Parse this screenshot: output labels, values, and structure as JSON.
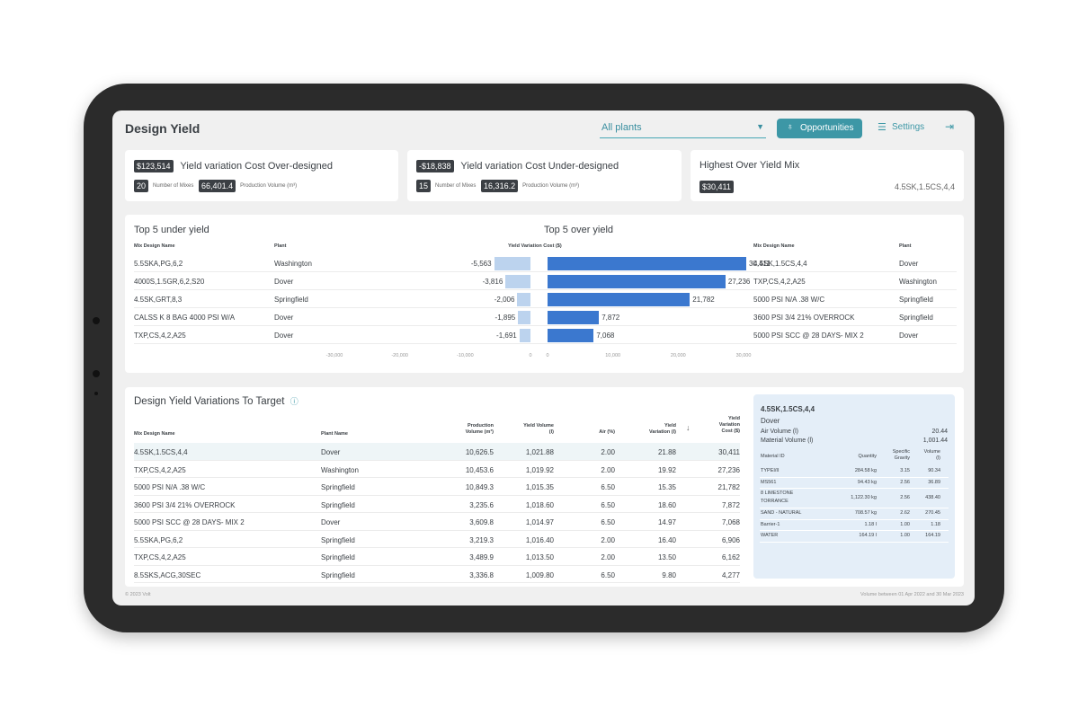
{
  "header": {
    "title": "Design Yield",
    "plant_select": "All plants",
    "opportunities_label": "Opportunities",
    "settings_label": "Settings"
  },
  "kpis": {
    "over": {
      "amount": "$123,514",
      "title": "Yield variation Cost Over-designed",
      "mixes": "20",
      "mixes_label": "Number of Mixes",
      "volume": "66,401.4",
      "volume_label": "Production Volume (m³)"
    },
    "under": {
      "amount": "-$18,838",
      "title": "Yield variation Cost Under-designed",
      "mixes": "15",
      "mixes_label": "Number of Mixes",
      "volume": "16,316.2",
      "volume_label": "Production Volume (m³)"
    },
    "highest": {
      "title": "Highest Over Yield Mix",
      "amount": "$30,411",
      "mix": "4.5SK,1.5CS,4,4"
    }
  },
  "top5": {
    "under_title": "Top 5 under yield",
    "over_title": "Top 5 over yield",
    "col_mix": "Mix Design Name",
    "col_plant": "Plant",
    "col_cost": "Yield Variation Cost ($)",
    "under_rows": [
      {
        "mix": "5.5SKA,PG,6,2",
        "plant": "Washington",
        "value": -5563,
        "label": "-5,563"
      },
      {
        "mix": "4000S,1.5GR,6,2,S20",
        "plant": "Dover",
        "value": -3816,
        "label": "-3,816"
      },
      {
        "mix": "4.5SK,GRT,8,3",
        "plant": "Springfield",
        "value": -2006,
        "label": "-2,006"
      },
      {
        "mix": "CALSS K 8 BAG 4000 PSI W/A",
        "plant": "Dover",
        "value": -1895,
        "label": "-1,895"
      },
      {
        "mix": "TXP,CS,4,2,A25",
        "plant": "Dover",
        "value": -1691,
        "label": "-1,691"
      }
    ],
    "over_rows": [
      {
        "mix": "4.5SK,1.5CS,4,4",
        "plant": "Dover",
        "value": 30411,
        "label": "30,411"
      },
      {
        "mix": "TXP,CS,4,2,A25",
        "plant": "Washington",
        "value": 27236,
        "label": "27,236"
      },
      {
        "mix": "5000 PSI N/A .38 W/C",
        "plant": "Springfield",
        "value": 21782,
        "label": "21,782"
      },
      {
        "mix": "3600 PSI 3/4 21% OVERROCK",
        "plant": "Springfield",
        "value": 7872,
        "label": "7,872"
      },
      {
        "mix": "5000 PSI SCC @ 28 DAYS- MIX 2",
        "plant": "Dover",
        "value": 7068,
        "label": "7,068"
      }
    ],
    "axis_under": [
      "-30,000",
      "-20,000",
      "-10,000",
      "0"
    ],
    "axis_over": [
      "0",
      "10,000",
      "20,000",
      "30,000"
    ]
  },
  "variations": {
    "title": "Design Yield Variations To Target",
    "info_icon": "info-icon",
    "columns": {
      "mix": "Mix Design Name",
      "plant": "Plant Name",
      "prod_1": "Production",
      "prod_2": "Volume (m³)",
      "yv_1": "Yield Volume",
      "yv_2": "(l)",
      "air": "Air (%)",
      "yvar_1": "Yield",
      "yvar_2": "Variation (l)",
      "cost_1": "Yield",
      "cost_2": "Variation",
      "cost_3": "Cost ($)"
    },
    "rows": [
      {
        "mix": "4.5SK,1.5CS,4,4",
        "plant": "Dover",
        "prod": "10,626.5",
        "yv": "1,021.88",
        "air": "2.00",
        "yvar": "21.88",
        "cost": "30,411"
      },
      {
        "mix": "TXP,CS,4,2,A25",
        "plant": "Washington",
        "prod": "10,453.6",
        "yv": "1,019.92",
        "air": "2.00",
        "yvar": "19.92",
        "cost": "27,236"
      },
      {
        "mix": "5000 PSI N/A .38 W/C",
        "plant": "Springfield",
        "prod": "10,849.3",
        "yv": "1,015.35",
        "air": "6.50",
        "yvar": "15.35",
        "cost": "21,782"
      },
      {
        "mix": "3600 PSI 3/4 21% OVERROCK",
        "plant": "Springfield",
        "prod": "3,235.6",
        "yv": "1,018.60",
        "air": "6.50",
        "yvar": "18.60",
        "cost": "7,872"
      },
      {
        "mix": "5000 PSI SCC @ 28 DAYS- MIX 2",
        "plant": "Dover",
        "prod": "3,609.8",
        "yv": "1,014.97",
        "air": "6.50",
        "yvar": "14.97",
        "cost": "7,068"
      },
      {
        "mix": "5.5SKA,PG,6,2",
        "plant": "Springfield",
        "prod": "3,219.3",
        "yv": "1,016.40",
        "air": "2.00",
        "yvar": "16.40",
        "cost": "6,906"
      },
      {
        "mix": "TXP,CS,4,2,A25",
        "plant": "Springfield",
        "prod": "3,489.9",
        "yv": "1,013.50",
        "air": "2.00",
        "yvar": "13.50",
        "cost": "6,162"
      },
      {
        "mix": "8.5SKS,ACG,30SEC",
        "plant": "Springfield",
        "prod": "3,336.8",
        "yv": "1,009.80",
        "air": "6.50",
        "yvar": "9.80",
        "cost": "4,277"
      }
    ]
  },
  "detail": {
    "mix": "4.5SK,1.5CS,4,4",
    "plant": "Dover",
    "air_label": "Air Volume (l)",
    "air_value": "20.44",
    "mat_label": "Material Volume (l)",
    "mat_value": "1,001.44",
    "col_id": "Material ID",
    "col_qty": "Quantity",
    "col_sg_1": "Specific",
    "col_sg_2": "Gravity",
    "col_vol_1": "Volume",
    "col_vol_2": "(l)",
    "materials": [
      {
        "id": "TYPEI/II",
        "id2": "",
        "qty": "284.58 kg",
        "sg": "3.15",
        "vol": "90.34"
      },
      {
        "id": "MS561",
        "id2": "",
        "qty": "94.43 kg",
        "sg": "2.56",
        "vol": "36.89"
      },
      {
        "id": "8 LIMESTONE",
        "id2": "TORRANCE",
        "qty": "1,122.30 kg",
        "sg": "2.56",
        "vol": "438.40"
      },
      {
        "id": "SAND - NATURAL",
        "id2": "",
        "qty": "708.57 kg",
        "sg": "2.62",
        "vol": "270.45"
      },
      {
        "id": "Barrier-1",
        "id2": "",
        "qty": "1.18 l",
        "sg": "1.00",
        "vol": "1.18"
      },
      {
        "id": "WATER",
        "id2": "",
        "qty": "164.19 l",
        "sg": "1.00",
        "vol": "164.19"
      }
    ]
  },
  "footer": {
    "copyright": "© 2023 Volt",
    "range": "Volume between 01 Apr 2022 and 30 Mar 2023"
  },
  "colors": {
    "accent": "#3d97a6",
    "bar_over": "#3b78cf",
    "bar_under": "#bcd3ee",
    "dark_pill": "#3b3f44"
  }
}
